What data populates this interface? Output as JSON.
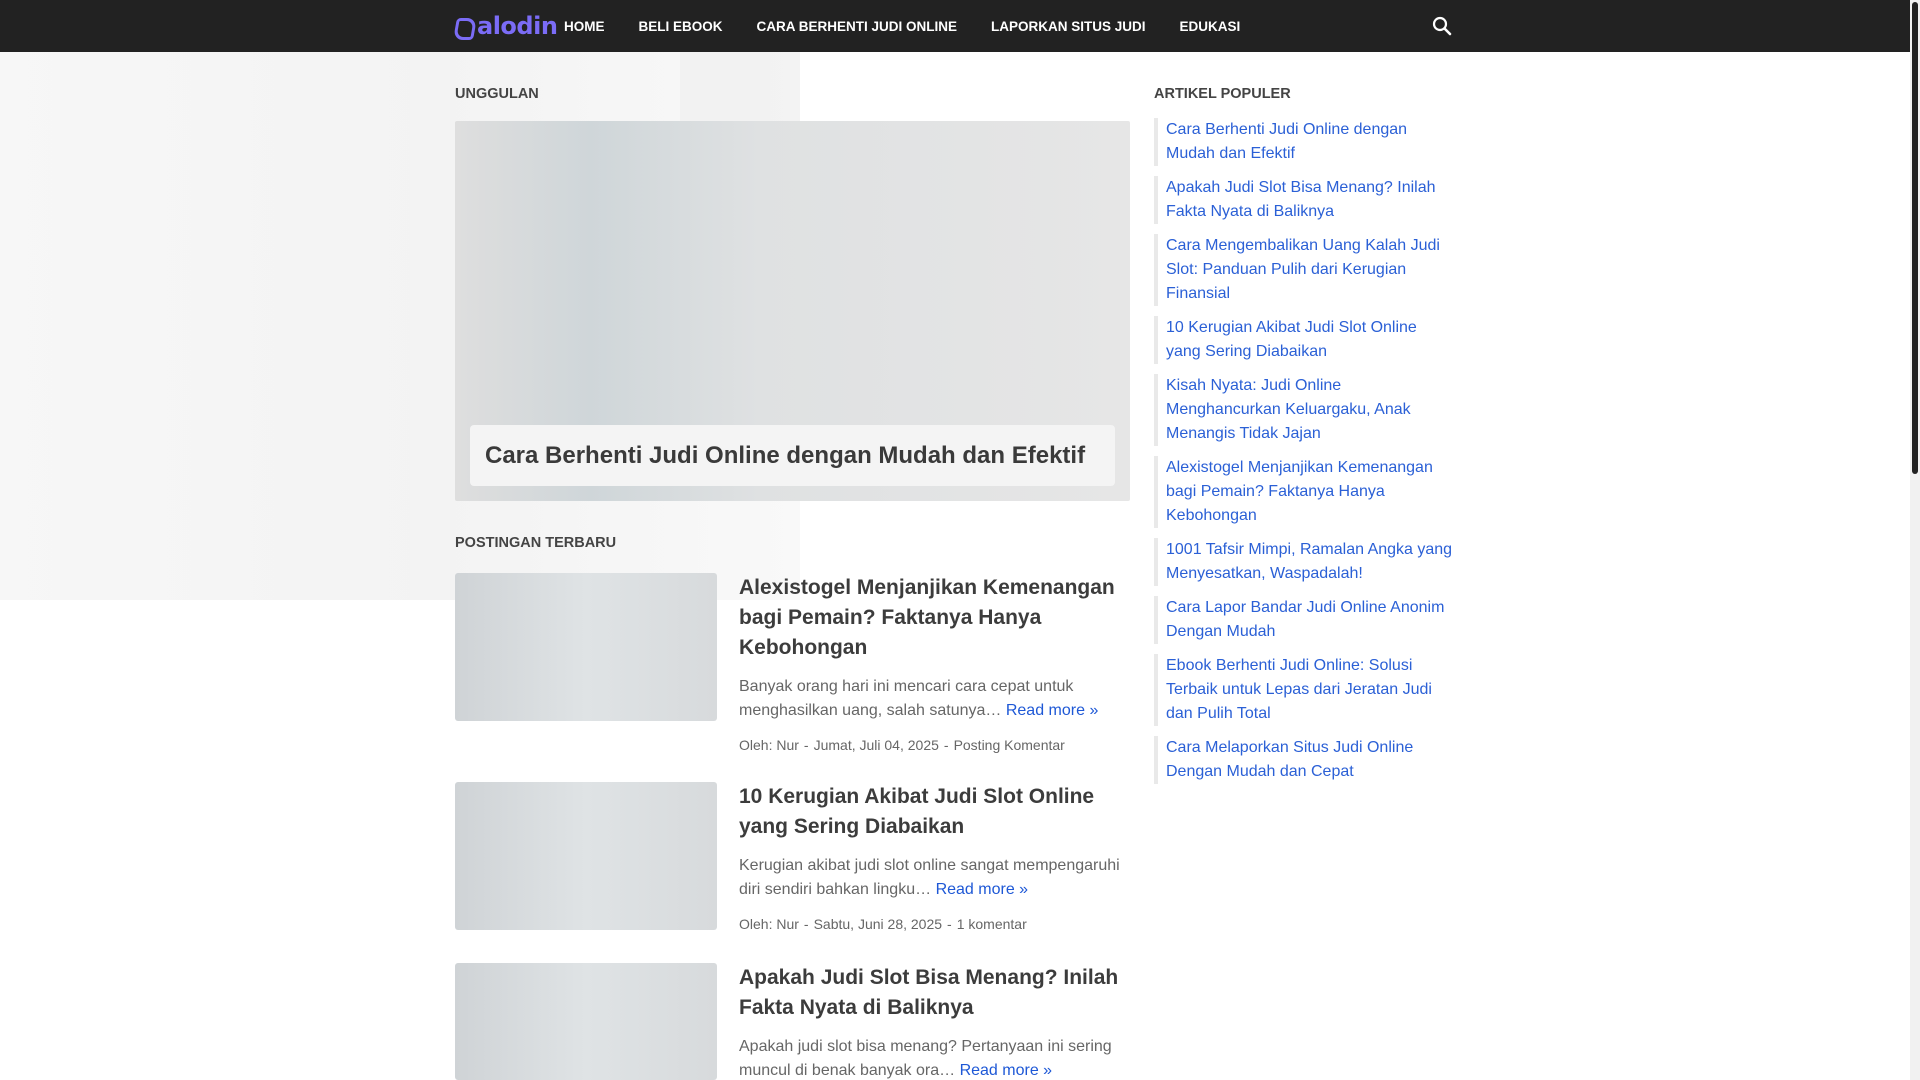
{
  "header": {
    "logo_text": "alodin",
    "nav": [
      "HOME",
      "BELI EBOOK",
      "CARA BERHENTI JUDI ONLINE",
      "LAPORKAN SITUS JUDI",
      "EDUKASI"
    ]
  },
  "featured": {
    "section_label": "UNGGULAN",
    "title": "Cara Berhenti Judi Online dengan Mudah dan Efektif"
  },
  "recent": {
    "section_label": "POSTINGAN TERBARU",
    "read_more": "Read more »",
    "posts": [
      {
        "title": "Alexistogel Menjanjikan Kemenangan bagi Pemain? Faktanya Hanya Kebohongan",
        "snippet": "Banyak orang hari ini mencari cara cepat untuk menghasilkan uang, salah satunya…",
        "author": "Oleh: Nur",
        "date": "Jumat, Juli 04, 2025",
        "comments": "Posting Komentar"
      },
      {
        "title": "10 Kerugian Akibat Judi Slot Online yang Sering Diabaikan",
        "snippet": "Kerugian akibat judi slot online sangat mempengaruhi diri sendiri bahkan lingku…",
        "author": "Oleh: Nur",
        "date": "Sabtu, Juni 28, 2025",
        "comments": "1 komentar"
      },
      {
        "title": "Apakah Judi Slot Bisa Menang? Inilah Fakta Nyata di Baliknya",
        "snippet": "Apakah judi slot bisa menang? Pertanyaan ini sering muncul di benak banyak ora…",
        "author": "",
        "date": "",
        "comments": ""
      }
    ]
  },
  "popular": {
    "section_label": "ARTIKEL POPULER",
    "items": [
      "Cara Berhenti Judi Online dengan Mudah dan Efektif",
      "Apakah Judi Slot Bisa Menang? Inilah Fakta Nyata di Baliknya",
      "Cara Mengembalikan Uang Kalah Judi Slot: Panduan Pulih dari Kerugian Finansial",
      "10 Kerugian Akibat Judi Slot Online yang Sering Diabaikan",
      "Kisah Nyata: Judi Online Menghancurkan Keluargaku, Anak Menangis Tidak Jajan",
      "Alexistogel Menjanjikan Kemenangan bagi Pemain? Faktanya Hanya Kebohongan",
      "1001 Tafsir Mimpi, Ramalan Angka yang Menyesatkan, Waspadalah!",
      "Cara Lapor Bandar Judi Online Anonim Dengan Mudah",
      "Ebook Berhenti Judi Online: Solusi Terbaik untuk Lepas dari Jeratan Judi dan Pulih Total",
      "Cara Melaporkan Situs Judi Online Dengan Mudah dan Cepat"
    ]
  },
  "colors": {
    "nav_bg": "#222222",
    "logo": "#7b6cf6",
    "link": "#2b60d6"
  },
  "icons": {
    "search": "search-icon"
  }
}
